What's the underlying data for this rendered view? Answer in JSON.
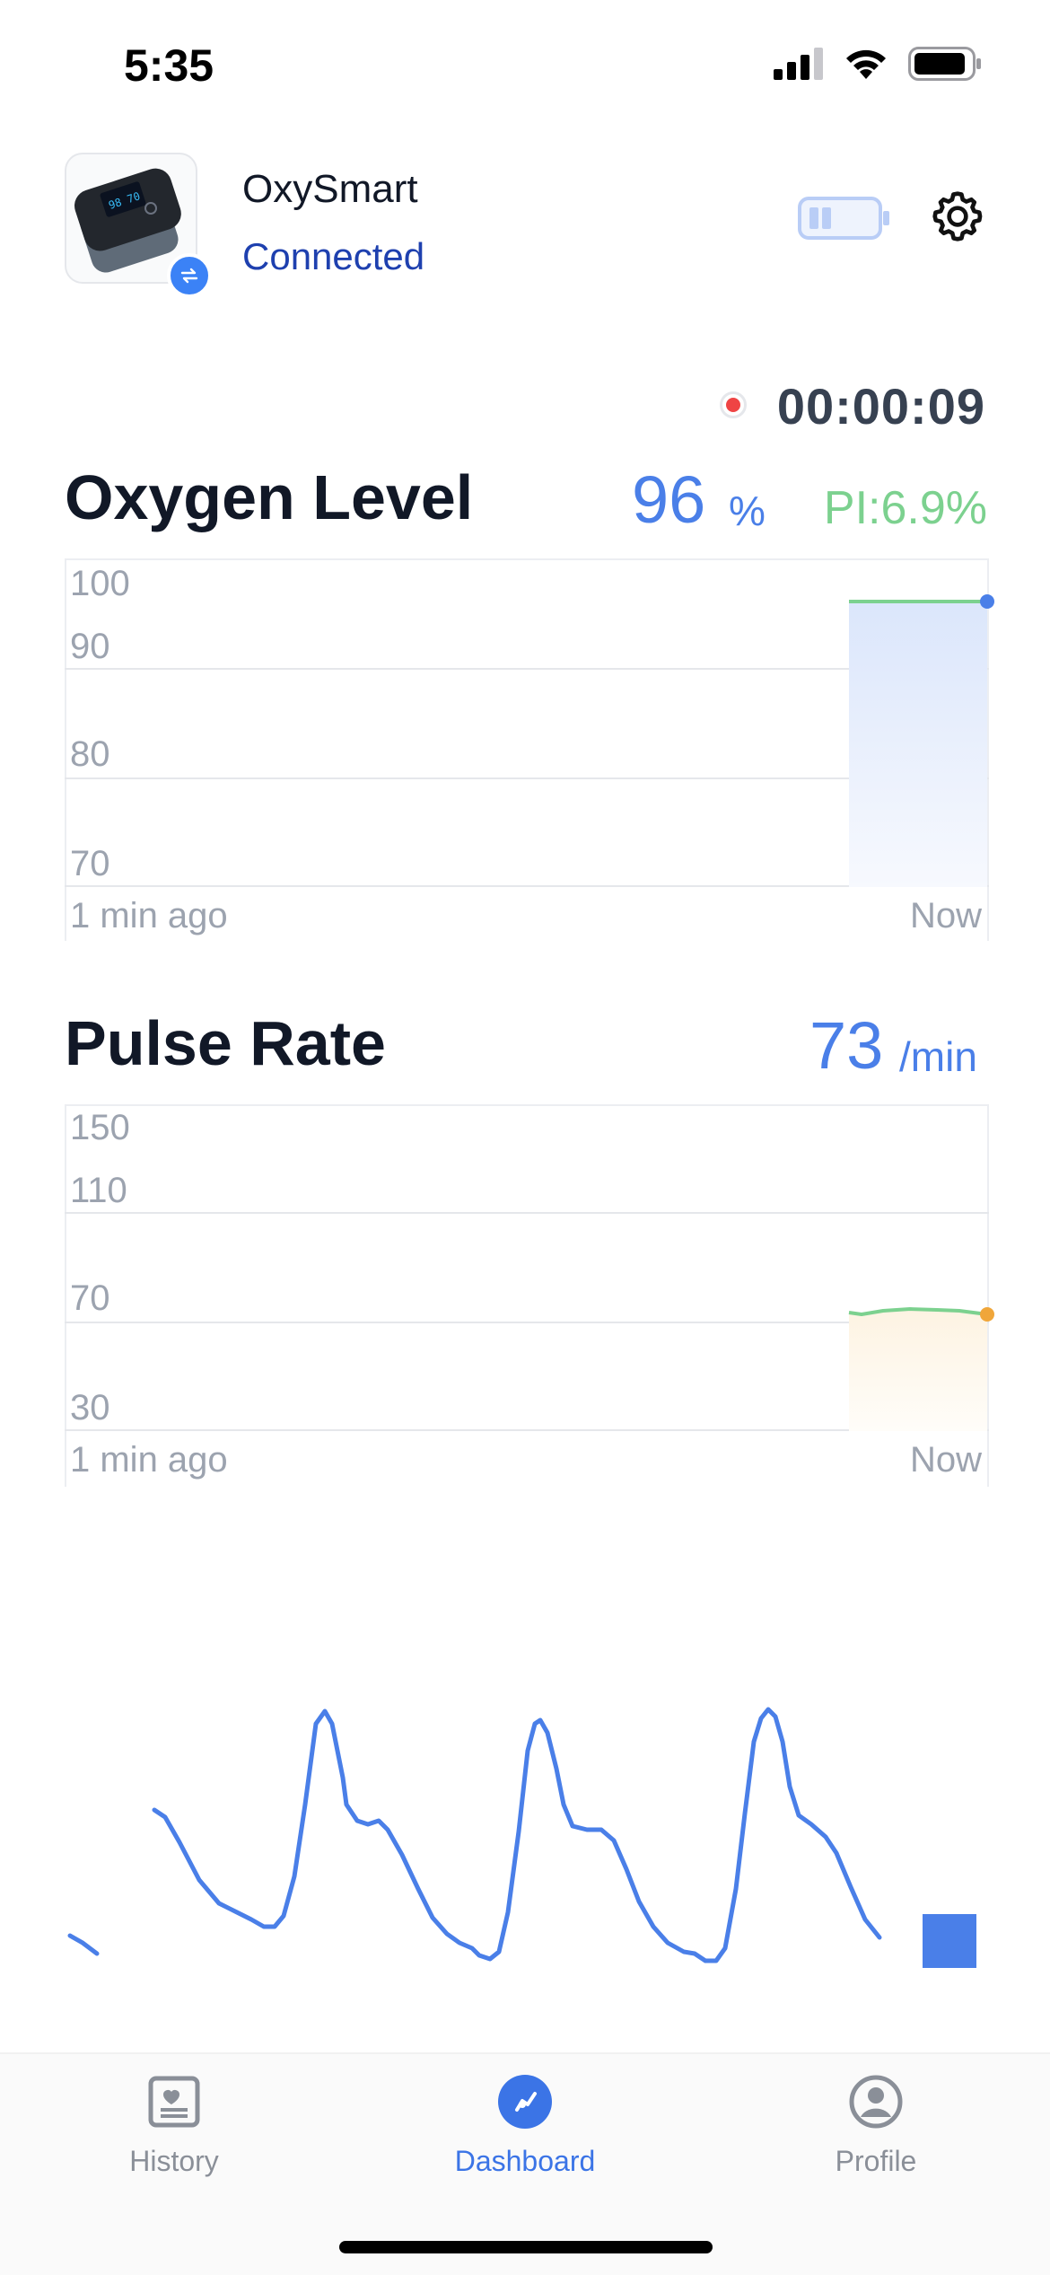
{
  "status_bar": {
    "time": "5:35"
  },
  "device": {
    "name": "OxySmart",
    "status": "Connected"
  },
  "session": {
    "timer": "00:00:09"
  },
  "oxygen": {
    "title": "Oxygen Level",
    "value": "96",
    "unit": "%",
    "pi": "PI:6.9%",
    "chart": {
      "y_ticks": [
        "100",
        "90",
        "80",
        "70"
      ],
      "x_start": "1 min ago",
      "x_end": "Now",
      "line_color": "#7cd18f",
      "dot_color": "#4a7fe8",
      "fill_color": "#dbe6fb"
    }
  },
  "pulse": {
    "title": "Pulse Rate",
    "value": "73",
    "unit": "/min",
    "chart": {
      "y_ticks": [
        "150",
        "110",
        "70",
        "30"
      ],
      "x_start": "1 min ago",
      "x_end": "Now",
      "line_color": "#7cd18f",
      "dot_color": "#f0a63a",
      "fill_color": "#fdf6e9"
    }
  },
  "waveform": {
    "color": "#4a7fe8"
  },
  "nav": {
    "items": [
      {
        "label": "History",
        "icon": "history-icon",
        "active": false
      },
      {
        "label": "Dashboard",
        "icon": "dashboard-icon",
        "active": true
      },
      {
        "label": "Profile",
        "icon": "profile-icon",
        "active": false
      }
    ]
  },
  "colors": {
    "accent": "#4a7fe8",
    "connected": "#1e40af",
    "pi": "#7cd18f",
    "record": "#ef4444"
  }
}
